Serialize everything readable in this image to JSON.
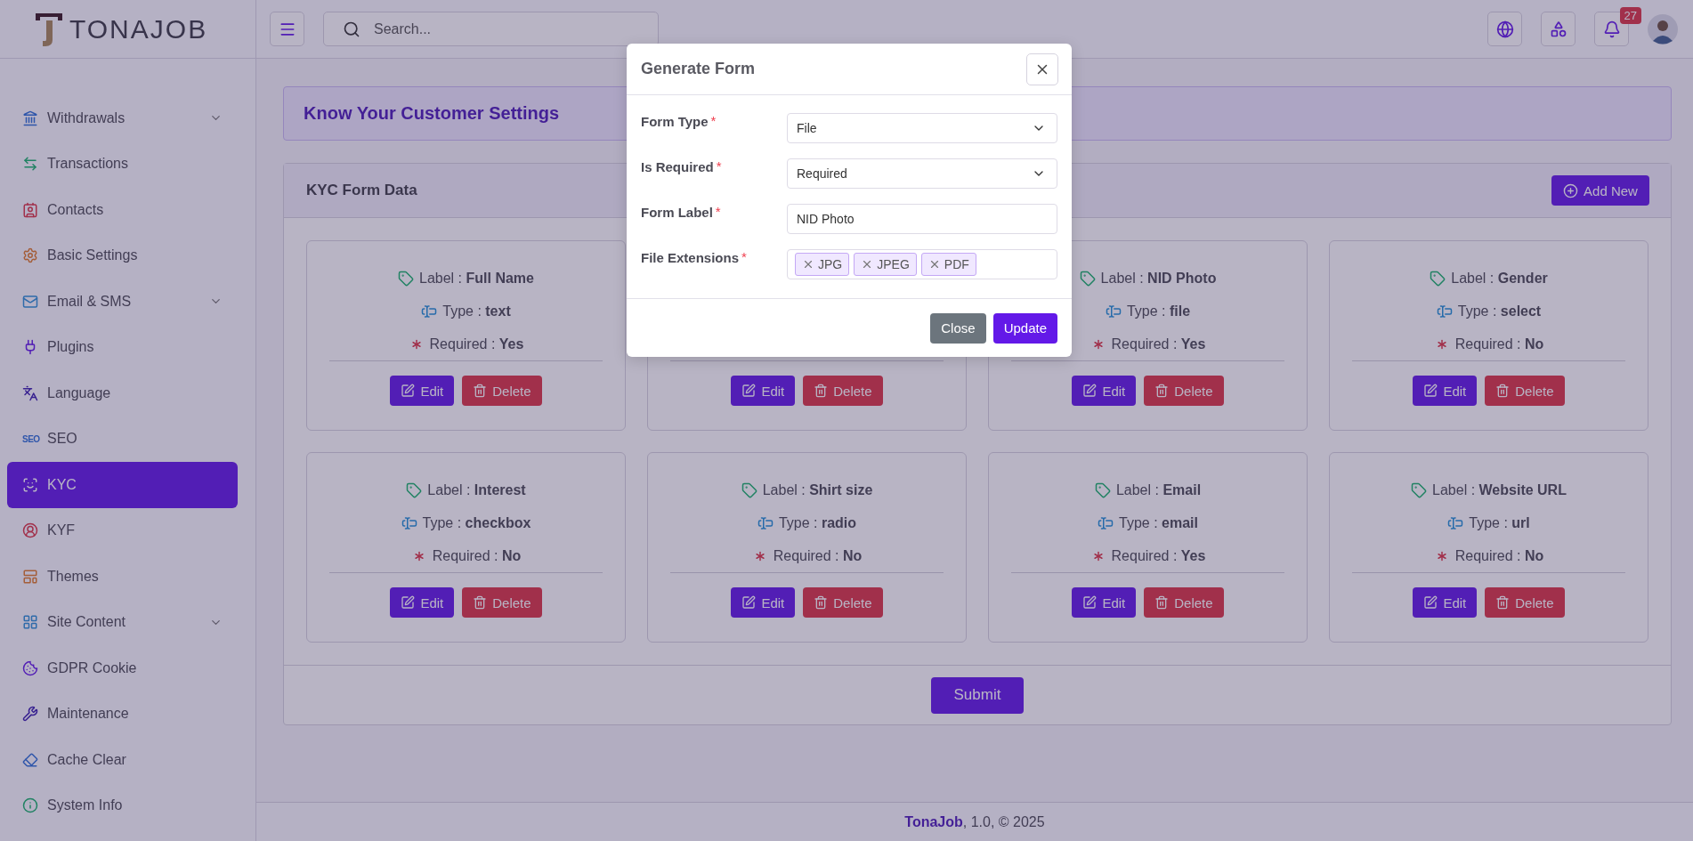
{
  "sidebar": {
    "logo": "TONAJOB",
    "items": [
      {
        "label": "Withdrawals",
        "expandable": true,
        "selected": false
      },
      {
        "label": "Transactions",
        "expandable": false,
        "selected": false
      },
      {
        "label": "Contacts",
        "expandable": false,
        "selected": false
      },
      {
        "label": "Basic Settings",
        "expandable": false,
        "selected": false
      },
      {
        "label": "Email & SMS",
        "expandable": true,
        "selected": false
      },
      {
        "label": "Plugins",
        "expandable": false,
        "selected": false
      },
      {
        "label": "Language",
        "expandable": false,
        "selected": false
      },
      {
        "label": "SEO",
        "icon_text": "SEO",
        "expandable": false,
        "selected": false
      },
      {
        "label": "KYC",
        "expandable": false,
        "selected": true
      },
      {
        "label": "KYF",
        "expandable": false,
        "selected": false
      },
      {
        "label": "Themes",
        "expandable": false,
        "selected": false
      },
      {
        "label": "Site Content",
        "expandable": true,
        "selected": false
      },
      {
        "label": "GDPR Cookie",
        "expandable": false,
        "selected": false
      },
      {
        "label": "Maintenance",
        "expandable": false,
        "selected": false
      },
      {
        "label": "Cache Clear",
        "expandable": false,
        "selected": false
      },
      {
        "label": "System Info",
        "expandable": false,
        "selected": false
      }
    ]
  },
  "topbar": {
    "search": {
      "placeholder": "Search..."
    },
    "notification_count": "27"
  },
  "page": {
    "title": "Know Your Customer Settings"
  },
  "panel": {
    "title": "KYC Form Data",
    "add_button": "Add New",
    "submit_button": "Submit",
    "cards": [
      {
        "lines": [
          "Label : **Full Name**",
          "Type : **text**",
          "Required : **Yes**"
        ],
        "edit": "Edit",
        "delete": "Delete"
      },
      {
        "edit": "Edit",
        "delete": "Delete"
      },
      {
        "lines": [
          "Label : **NID Photo**",
          "Type : **file**",
          "Required : **Yes**"
        ],
        "edit": "Edit",
        "delete": "Delete"
      },
      {
        "lines": [
          "Label : **Gender**",
          "Type : **select**",
          "Required : **No**"
        ],
        "edit": "Edit",
        "delete": "Delete"
      },
      {
        "lines": [
          "Label : **Interest**",
          "Type : **checkbox**",
          "Required : **No**"
        ],
        "edit": "Edit",
        "delete": "Delete"
      },
      {
        "lines": [
          "Label : **Shirt size**",
          "Type : **radio**",
          "Required : **No**"
        ],
        "edit": "Edit",
        "delete": "Delete"
      },
      {
        "lines": [
          "Label : **Email**",
          "Type : **email**",
          "Required : **Yes**"
        ],
        "edit": "Edit",
        "delete": "Delete"
      },
      {
        "lines": [
          "Label : **Website URL**",
          "Type : **url**",
          "Required : **No**"
        ],
        "edit": "Edit",
        "delete": "Delete"
      }
    ]
  },
  "modal": {
    "title": "Generate Form",
    "fields": [
      {
        "kind": "select",
        "label": "Form Type",
        "required_mark": "*",
        "value": "File"
      },
      {
        "kind": "select",
        "label": "Is Required",
        "required_mark": "*",
        "value": "Required"
      },
      {
        "kind": "input",
        "label": "Form Label",
        "required_mark": "*",
        "value": "NID Photo"
      },
      {
        "kind": "tags",
        "label": "File Extensions",
        "required_mark": "*",
        "tags": [
          "JPG",
          "JPEG",
          "PDF"
        ]
      }
    ],
    "close_button": "Close",
    "update_button": "Update"
  },
  "footer": "**TonaJob**, 1.0, © 2025"
}
